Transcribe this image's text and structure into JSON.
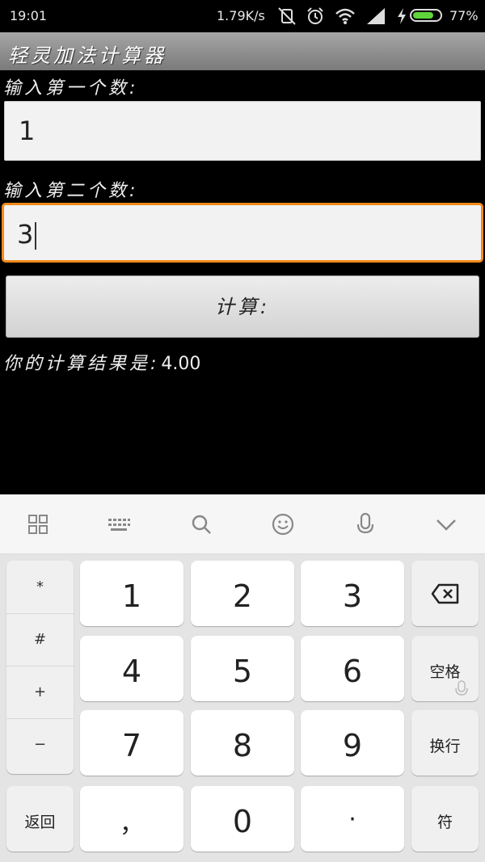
{
  "status_bar": {
    "time": "19:01",
    "net_speed": "1.79K/s",
    "battery_pct": "77%",
    "battery_level": 0.77,
    "icons": [
      "vibrate-off-icon",
      "alarm-icon",
      "wifi-icon",
      "signal-icon",
      "charging-icon",
      "battery-icon"
    ]
  },
  "app": {
    "title": "轻灵加法计算器",
    "first_label": "输入第一个数:",
    "first_value": "1",
    "second_label": "输入第二个数:",
    "second_value": "3",
    "calc_button": "计算:",
    "result_label": "你的计算结果是:",
    "result_value": "4.00",
    "accent_color": "#f28a1a"
  },
  "keyboard": {
    "toolbar_icons": [
      "grid-icon",
      "keyboard-icon",
      "search-icon",
      "emoji-icon",
      "mic-icon",
      "chevron-down-icon"
    ],
    "symbols": [
      "*",
      "#",
      "+",
      "−"
    ],
    "digits": [
      "1",
      "2",
      "3",
      "4",
      "5",
      "6",
      "7",
      "8",
      "9"
    ],
    "back_key": "返回",
    "comma_key": "，",
    "zero_key": "0",
    "dot_key": "·",
    "space_key": "空格",
    "newline_key": "换行",
    "symbol_key": "符"
  }
}
